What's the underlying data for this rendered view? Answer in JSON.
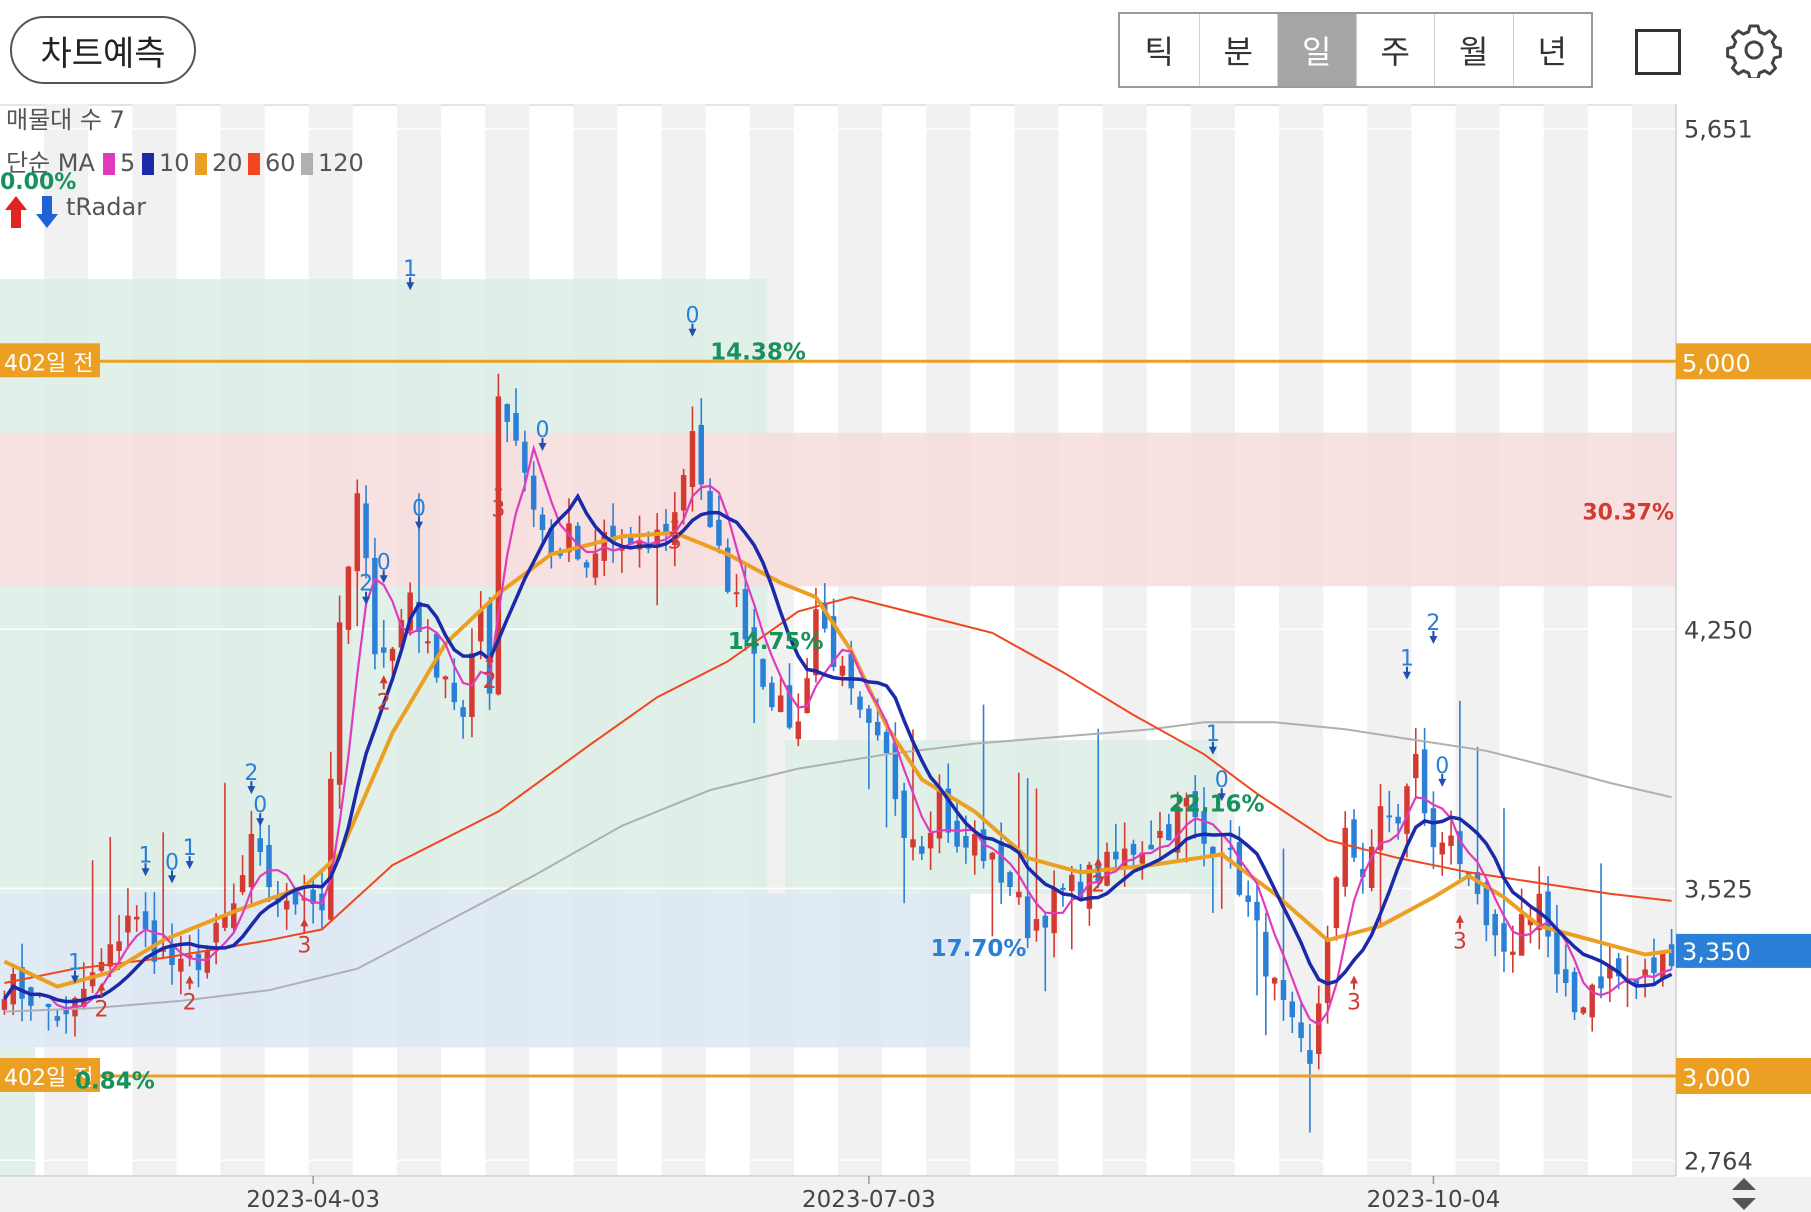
{
  "toolbar": {
    "predict_label": "차트예측",
    "periods": [
      "틱",
      "분",
      "일",
      "주",
      "월",
      "년"
    ],
    "active_period": "일"
  },
  "indicators": {
    "volume_profile": "매물대 수 7",
    "ma_prefix": "단순 MA",
    "ma_items": [
      {
        "label": "5",
        "color": "#e03bbd"
      },
      {
        "label": "10",
        "color": "#1a2aa8"
      },
      {
        "label": "20",
        "color": "#eba024"
      },
      {
        "label": "60",
        "color": "#f0471e"
      },
      {
        "label": "120",
        "color": "#b0b0b0"
      }
    ],
    "radar_label": "tRadar",
    "radar_pct": "0.00%"
  },
  "colors": {
    "up": "#d33b32",
    "down": "#2a7fd6",
    "hline": "#eba024",
    "current": "#2a7fd6",
    "zone_green": "#dcefe6",
    "zone_red": "#f7dcdc",
    "zone_blue": "#dce8f5"
  },
  "chart_data": {
    "type": "candlestick",
    "y_ticks": [
      "5,651",
      "4,250",
      "3,525",
      "2,764"
    ],
    "y_tick_values": [
      5651,
      4250,
      3525,
      2764
    ],
    "ylim": [
      2720,
      5720
    ],
    "x_tick_labels": [
      "2023-04-03",
      "2023-07-03",
      "2023-10-04"
    ],
    "x_tick_index": [
      35,
      98,
      162
    ],
    "n_days": 190,
    "horizontal_lines": [
      {
        "label": "402일 전",
        "value": 5000,
        "value_label": "5,000"
      },
      {
        "label": "402일 전",
        "value": 3000,
        "value_label": "3,000"
      }
    ],
    "current_price": {
      "value": 3350,
      "label": "3,350"
    },
    "zones": [
      {
        "x0": 0,
        "x1": 87,
        "y_lo": 4800,
        "y_hi": 5230,
        "kind": "green"
      },
      {
        "x0": 0,
        "x1": 190,
        "y_lo": 4370,
        "y_hi": 4800,
        "kind": "red",
        "label": "30.37%"
      },
      {
        "x0": 0,
        "x1": 87,
        "y_lo": 3510,
        "y_hi": 4370,
        "kind": "green"
      },
      {
        "x0": 89,
        "x1": 138,
        "y_lo": 3510,
        "y_hi": 3940,
        "kind": "green"
      },
      {
        "x0": 0,
        "x1": 110,
        "y_lo": 3080,
        "y_hi": 3510,
        "kind": "blue"
      },
      {
        "x0": 0,
        "x1": 4,
        "y_lo": 2720,
        "y_hi": 3080,
        "kind": "green"
      }
    ],
    "pct_labels": [
      {
        "text": "14.38%",
        "x": 80,
        "y": 5005,
        "color": "#16925a"
      },
      {
        "text": "14.75%",
        "x": 82,
        "y": 4195,
        "color": "#16925a"
      },
      {
        "text": "17.70%",
        "x": 105,
        "y": 3335,
        "color": "#2a7fd6"
      },
      {
        "text": "22.16%",
        "x": 132,
        "y": 3740,
        "color": "#16925a"
      },
      {
        "text": "0.84%",
        "x": 8,
        "y": 2965,
        "color": "#16925a"
      }
    ],
    "signals": [
      {
        "i": 8,
        "kind": "down",
        "n": "1",
        "y": 3270
      },
      {
        "i": 11,
        "kind": "up",
        "n": "2",
        "y": 3250
      },
      {
        "i": 16,
        "kind": "down",
        "n": "1",
        "y": 3570
      },
      {
        "i": 19,
        "kind": "down",
        "n": "0",
        "y": 3550
      },
      {
        "i": 21,
        "kind": "down",
        "n": "1",
        "y": 3590
      },
      {
        "i": 21,
        "kind": "up",
        "n": "2",
        "y": 3270
      },
      {
        "i": 28,
        "kind": "down",
        "n": "2",
        "y": 3800
      },
      {
        "i": 29,
        "kind": "down",
        "n": "0",
        "y": 3710
      },
      {
        "i": 34,
        "kind": "up",
        "n": "3",
        "y": 3430
      },
      {
        "i": 41,
        "kind": "down",
        "n": "2",
        "y": 4330
      },
      {
        "i": 43,
        "kind": "down",
        "n": "0",
        "y": 4390
      },
      {
        "i": 43,
        "kind": "up",
        "n": "2",
        "y": 4110
      },
      {
        "i": 46,
        "kind": "down",
        "n": "1",
        "y": 5210
      },
      {
        "i": 47,
        "kind": "down",
        "n": "0",
        "y": 4540
      },
      {
        "i": 55,
        "kind": "up",
        "n": "2",
        "y": 4170
      },
      {
        "i": 56,
        "kind": "up",
        "n": "3",
        "y": 4650
      },
      {
        "i": 61,
        "kind": "down",
        "n": "0",
        "y": 4760
      },
      {
        "i": 76,
        "kind": "up",
        "n": "3",
        "y": 4560
      },
      {
        "i": 78,
        "kind": "down",
        "n": "0",
        "y": 5080
      },
      {
        "i": 124,
        "kind": "up",
        "n": "2",
        "y": 3600
      },
      {
        "i": 137,
        "kind": "down",
        "n": "1",
        "y": 3910
      },
      {
        "i": 138,
        "kind": "down",
        "n": "0",
        "y": 3780
      },
      {
        "i": 153,
        "kind": "up",
        "n": "3",
        "y": 3270
      },
      {
        "i": 159,
        "kind": "down",
        "n": "1",
        "y": 4120
      },
      {
        "i": 162,
        "kind": "down",
        "n": "2",
        "y": 4220
      },
      {
        "i": 163,
        "kind": "down",
        "n": "0",
        "y": 3820
      },
      {
        "i": 165,
        "kind": "up",
        "n": "3",
        "y": 3440
      }
    ],
    "keyframes": [
      [
        0,
        3260
      ],
      [
        4,
        3210
      ],
      [
        7,
        3150
      ],
      [
        9,
        3240
      ],
      [
        12,
        3340
      ],
      [
        14,
        3460
      ],
      [
        17,
        3360
      ],
      [
        20,
        3290
      ],
      [
        23,
        3350
      ],
      [
        26,
        3470
      ],
      [
        28,
        3640
      ],
      [
        30,
        3540
      ],
      [
        32,
        3460
      ],
      [
        34,
        3530
      ],
      [
        36,
        3470
      ],
      [
        38,
        4230
      ],
      [
        40,
        4610
      ],
      [
        42,
        4220
      ],
      [
        44,
        4190
      ],
      [
        46,
        4360
      ],
      [
        48,
        4180
      ],
      [
        50,
        4130
      ],
      [
        52,
        3990
      ],
      [
        54,
        4300
      ],
      [
        55,
        4100
      ],
      [
        56,
        4910
      ],
      [
        58,
        4790
      ],
      [
        60,
        4600
      ],
      [
        62,
        4450
      ],
      [
        64,
        4510
      ],
      [
        66,
        4390
      ],
      [
        68,
        4510
      ],
      [
        70,
        4480
      ],
      [
        72,
        4460
      ],
      [
        74,
        4510
      ],
      [
        76,
        4570
      ],
      [
        78,
        4820
      ],
      [
        80,
        4510
      ],
      [
        82,
        4390
      ],
      [
        84,
        4260
      ],
      [
        86,
        4120
      ],
      [
        88,
        4020
      ],
      [
        90,
        3980
      ],
      [
        92,
        4310
      ],
      [
        95,
        4110
      ],
      [
        97,
        3990
      ],
      [
        100,
        3880
      ],
      [
        102,
        3710
      ],
      [
        104,
        3660
      ],
      [
        106,
        3790
      ],
      [
        108,
        3620
      ],
      [
        110,
        3660
      ],
      [
        112,
        3590
      ],
      [
        114,
        3540
      ],
      [
        116,
        3420
      ],
      [
        118,
        3460
      ],
      [
        120,
        3510
      ],
      [
        122,
        3540
      ],
      [
        124,
        3570
      ],
      [
        126,
        3600
      ],
      [
        128,
        3640
      ],
      [
        130,
        3660
      ],
      [
        132,
        3700
      ],
      [
        134,
        3760
      ],
      [
        136,
        3650
      ],
      [
        138,
        3660
      ],
      [
        140,
        3540
      ],
      [
        142,
        3400
      ],
      [
        144,
        3240
      ],
      [
        146,
        3120
      ],
      [
        148,
        3010
      ],
      [
        150,
        3410
      ],
      [
        152,
        3660
      ],
      [
        154,
        3580
      ],
      [
        156,
        3720
      ],
      [
        158,
        3720
      ],
      [
        160,
        3880
      ],
      [
        162,
        3620
      ],
      [
        164,
        3700
      ],
      [
        166,
        3520
      ],
      [
        168,
        3410
      ],
      [
        170,
        3310
      ],
      [
        172,
        3440
      ],
      [
        174,
        3510
      ],
      [
        176,
        3260
      ],
      [
        178,
        3180
      ],
      [
        180,
        3260
      ],
      [
        182,
        3290
      ],
      [
        185,
        3250
      ],
      [
        189,
        3350
      ]
    ],
    "ma_curves": {
      "ma20": [
        [
          0,
          3320
        ],
        [
          6,
          3250
        ],
        [
          12,
          3290
        ],
        [
          18,
          3380
        ],
        [
          26,
          3460
        ],
        [
          34,
          3530
        ],
        [
          38,
          3620
        ],
        [
          44,
          3960
        ],
        [
          50,
          4210
        ],
        [
          56,
          4350
        ],
        [
          62,
          4460
        ],
        [
          70,
          4510
        ],
        [
          76,
          4520
        ],
        [
          82,
          4460
        ],
        [
          88,
          4380
        ],
        [
          92,
          4340
        ],
        [
          96,
          4190
        ],
        [
          100,
          3980
        ],
        [
          104,
          3830
        ],
        [
          110,
          3740
        ],
        [
          116,
          3610
        ],
        [
          122,
          3570
        ],
        [
          130,
          3590
        ],
        [
          138,
          3620
        ],
        [
          144,
          3510
        ],
        [
          150,
          3380
        ],
        [
          156,
          3420
        ],
        [
          162,
          3500
        ],
        [
          166,
          3560
        ],
        [
          170,
          3500
        ],
        [
          174,
          3420
        ],
        [
          180,
          3380
        ],
        [
          186,
          3340
        ],
        [
          189,
          3350
        ]
      ],
      "ma60": [
        [
          0,
          3260
        ],
        [
          8,
          3300
        ],
        [
          18,
          3330
        ],
        [
          30,
          3380
        ],
        [
          36,
          3410
        ],
        [
          44,
          3590
        ],
        [
          56,
          3740
        ],
        [
          66,
          3920
        ],
        [
          74,
          4060
        ],
        [
          82,
          4160
        ],
        [
          90,
          4300
        ],
        [
          96,
          4340
        ],
        [
          104,
          4290
        ],
        [
          112,
          4240
        ],
        [
          120,
          4130
        ],
        [
          128,
          4010
        ],
        [
          136,
          3900
        ],
        [
          142,
          3790
        ],
        [
          150,
          3660
        ],
        [
          158,
          3610
        ],
        [
          166,
          3570
        ],
        [
          174,
          3540
        ],
        [
          182,
          3510
        ],
        [
          189,
          3490
        ]
      ],
      "ma120": [
        [
          0,
          3180
        ],
        [
          10,
          3190
        ],
        [
          20,
          3210
        ],
        [
          30,
          3240
        ],
        [
          40,
          3300
        ],
        [
          50,
          3430
        ],
        [
          60,
          3560
        ],
        [
          70,
          3700
        ],
        [
          80,
          3800
        ],
        [
          90,
          3860
        ],
        [
          100,
          3900
        ],
        [
          110,
          3930
        ],
        [
          120,
          3950
        ],
        [
          130,
          3970
        ],
        [
          136,
          3990
        ],
        [
          144,
          3990
        ],
        [
          152,
          3970
        ],
        [
          160,
          3940
        ],
        [
          168,
          3910
        ],
        [
          176,
          3860
        ],
        [
          182,
          3820
        ],
        [
          189,
          3780
        ]
      ]
    }
  }
}
